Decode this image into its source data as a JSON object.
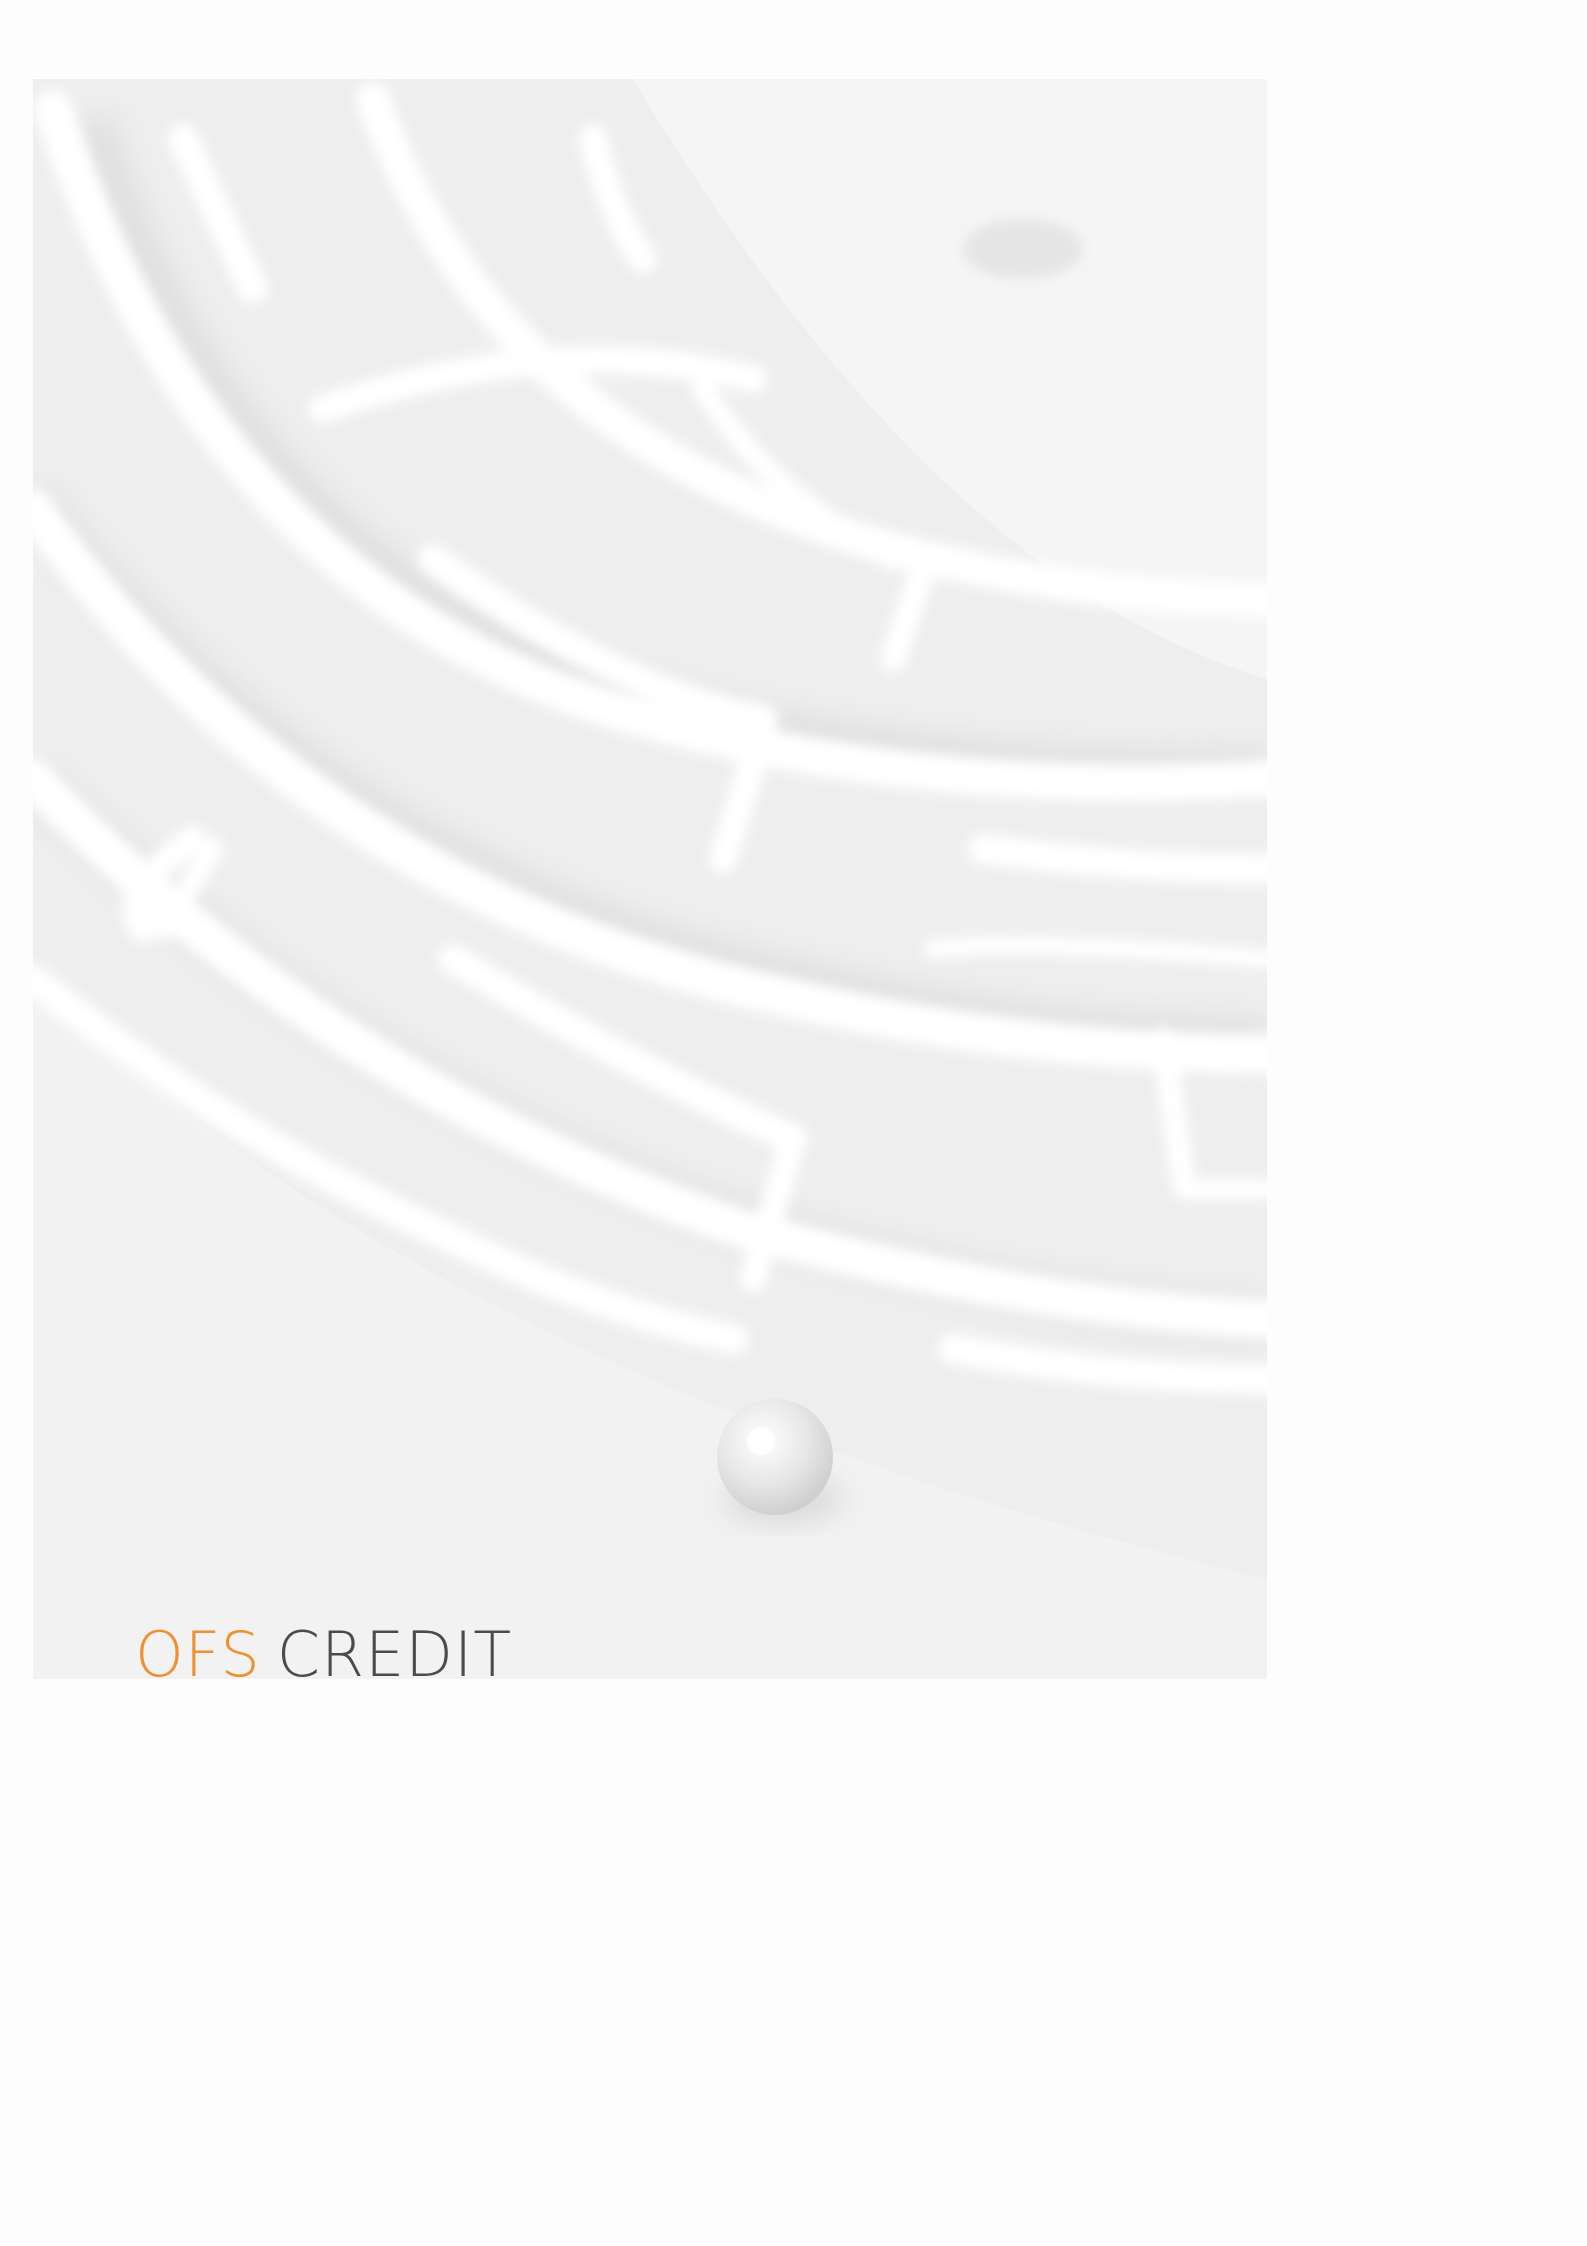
{
  "brand": {
    "ofs": "OFS",
    "credit": "CREDIT",
    "ofs_color": "#ef8f2d",
    "credit_color": "#4b4b4b"
  },
  "cover": {
    "image_subject": "maze-with-ball"
  }
}
